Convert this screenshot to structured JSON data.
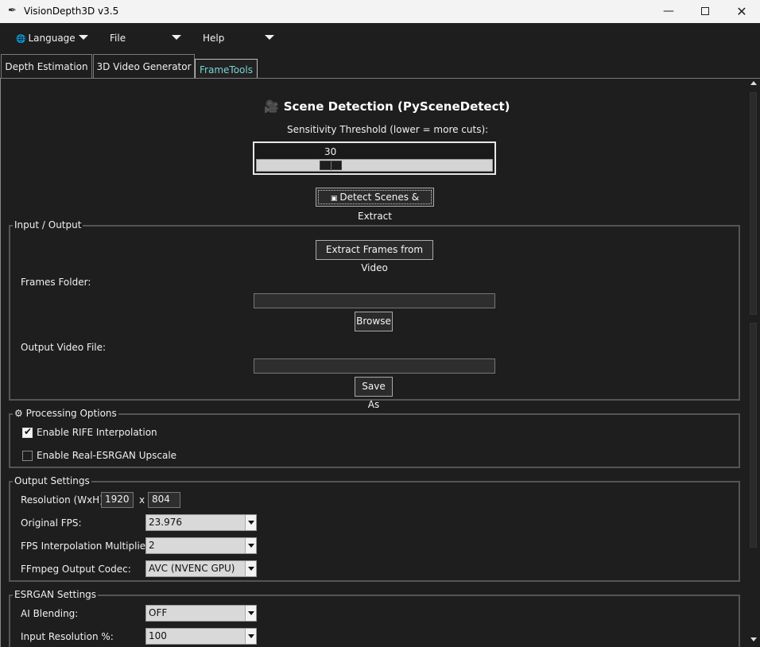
{
  "window": {
    "title": "VisionDepth3D v3.5"
  },
  "menu": {
    "language": "Language",
    "file": "File",
    "help": "Help"
  },
  "tabs": [
    {
      "label": "Depth Estimation"
    },
    {
      "label": "3D Video Generator"
    },
    {
      "label": "FrameTools",
      "active": true
    }
  ],
  "scene": {
    "title": "Scene Detection (PySceneDetect)",
    "sensitivity_label": "Sensitivity Threshold (lower = more cuts):",
    "threshold": "30",
    "threshold_value": 30,
    "detect_button": "Detect Scenes & Extract"
  },
  "io": {
    "legend": "Input / Output",
    "extract_button": "Extract Frames from Video",
    "frames_folder_label": "Frames Folder:",
    "frames_folder_value": "",
    "browse_button": "Browse",
    "output_file_label": "Output Video File:",
    "output_file_value": "",
    "save_button": "Save As"
  },
  "processing": {
    "legend": "Processing Options",
    "rife_label": "Enable RIFE Interpolation",
    "rife_checked": true,
    "esrgan_label": "Enable Real-ESRGAN Upscale",
    "esrgan_checked": false
  },
  "output": {
    "legend": "Output Settings",
    "resolution_label": "Resolution (WxH):",
    "width": "1920",
    "x_sep": "x",
    "height": "804",
    "fps_label": "Original FPS:",
    "fps_value": "23.976",
    "multiplier_label": "FPS Interpolation Multiplier:",
    "multiplier_value": "2",
    "codec_label": "FFmpeg Output Codec:",
    "codec_value": "AVC (NVENC GPU)"
  },
  "esrgan": {
    "legend": "ESRGAN Settings",
    "blending_label": "AI Blending:",
    "blending_value": "OFF",
    "input_res_label": "Input Resolution %:",
    "input_res_value": "100"
  },
  "colors": {
    "background": "#1e1e1e",
    "active_tab_text": "#79d2d8"
  }
}
